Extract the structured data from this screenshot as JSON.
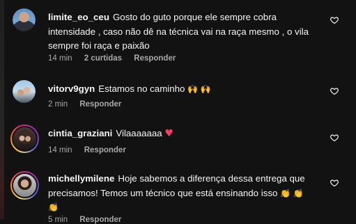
{
  "comments": [
    {
      "username": "limite_eo_ceu",
      "text": "Gosto do guto porque ele sempre cobra intensidade , caso não dê na técnica vai na raça mesmo , o vila sempre foi raça e paixão",
      "time": "14 min",
      "likes": "2 curtidas",
      "reply": "Responder"
    },
    {
      "username": "vitorv9gyn",
      "text": "Estamos no caminho",
      "emoji": "🙌 🙌",
      "time": "2 min",
      "reply": "Responder"
    },
    {
      "username": "cintia_graziani",
      "text": "Vilaaaaaaa",
      "emoji": "♥",
      "time": "14 min",
      "reply": "Responder"
    },
    {
      "username": "michellymilene",
      "text": "Hoje sabemos a diferença dessa entrega que precisamos! Temos um técnico que está ensinando isso",
      "emoji": "👏 👏",
      "emoji_line2": "👏",
      "time": "5 min",
      "reply": "Responder"
    }
  ],
  "colors": {
    "background": "#121212",
    "text": "#f5f5f5",
    "meta": "#a8a8a8",
    "heart_emoji": "#ff3b5c"
  },
  "icons": {
    "like": "heart-outline-icon"
  }
}
